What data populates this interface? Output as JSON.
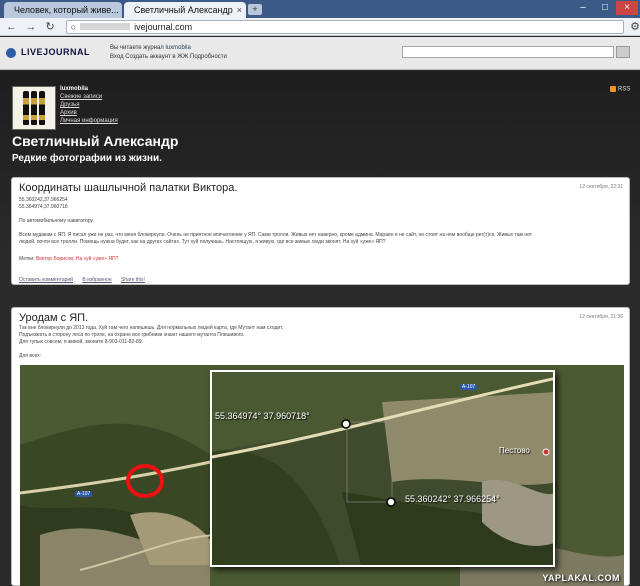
{
  "browser": {
    "tabs": [
      {
        "title": "Человек, который живе...",
        "active": false
      },
      {
        "title": "Светличный Александр",
        "active": true
      }
    ],
    "url_suffix": "ivejournal.com"
  },
  "lj": {
    "logo": "LIVEJOURNAL",
    "reading_label": "Вы читаете журнал",
    "reading_user": "luxmobila",
    "login_line": "Вход   Создать аккаунт в ЖЖ   Подробности"
  },
  "journal": {
    "username": "luxmobila",
    "nav": [
      "Свежие записи",
      "Друзья",
      "Архив",
      "Личная информация"
    ],
    "rss": "RSS",
    "title": "Светличный Александр",
    "subtitle": "Редкие фотографии из жизни."
  },
  "entry1": {
    "title": "Координаты шашлычной палатки Виктора.",
    "date": "12 сентября, 22:31",
    "coord1": "55.360242,37.966254",
    "coord2": "55.364974,37.960718",
    "intro": "По автомобильному навигатору.",
    "body1": "Всем мудакам с ЯП. Я писал уже не раз, что меня блокирнули. Очень не приятное впечатление у ЯП. Сами тролли. Живых нет наверно, кроме админа. Мараен я не сайт, не стоит на нем вообще рег(т)ся. Живых там нет",
    "body2": "людей, почти все тролли. Помощь нужна будет, как на других сайтах. Тут хуй получишь. Настоящую, я живую, где все живые люди звонят. На хуй «уже» ЯП?",
    "tags_label": "Метки:",
    "tags": "Виктор Борисов, На хуй «уже» ЯП?",
    "footer": [
      "Оставить комментарий",
      "В избранное",
      "Share this!"
    ]
  },
  "entry2": {
    "title": "Уродам с ЯП.",
    "date": "12 сентября, 21:36",
    "line1": "Так вне блокирнули до 2013 года. Хуй там чего напишешь. Для нормальных людей карта, где Мутант нам сходит.",
    "line2": "Подъезжать в сторону леса по тропе, на охране все грибники знают нашего мутанта Плешивого.",
    "line3": "Для тупых совсем, я живой, звоните 8-903-011-82-89.",
    "line4": "Для всех:"
  },
  "map": {
    "road_badge": "A-107",
    "road_badge_small": "A-107",
    "coord_upper": "55.364974°  37.960718°",
    "coord_lower": "55.360242°  37.966254°",
    "town": "Пестово",
    "watermark": "YAPLAKAL.COM"
  }
}
